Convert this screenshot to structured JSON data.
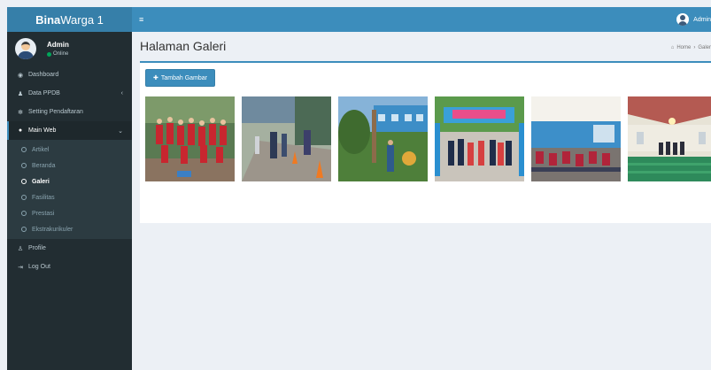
{
  "app": {
    "brand_bold": "Bina",
    "brand_rest": "Warga 1"
  },
  "user": {
    "name": "Admin",
    "status": "Online"
  },
  "topbar": {
    "menu_icon": "hamburger-icon",
    "user_label": "Admin"
  },
  "sidebar": {
    "items": [
      {
        "label": "Dashboard",
        "icon": "dashboard-icon"
      },
      {
        "label": "Data PPDB",
        "icon": "users-icon",
        "caret": "‹"
      },
      {
        "label": "Setting Pendaftaran",
        "icon": "gear-icon"
      },
      {
        "label": "Main Web",
        "icon": "globe-icon",
        "caret": "⌄"
      }
    ],
    "sub_items": [
      {
        "label": "Artikel"
      },
      {
        "label": "Beranda"
      },
      {
        "label": "Galeri"
      },
      {
        "label": "Fasilitas"
      },
      {
        "label": "Prestasi"
      },
      {
        "label": "Ekstrakurikuler"
      }
    ],
    "bottom_items": [
      {
        "label": "Profile",
        "icon": "user-icon"
      },
      {
        "label": "Log Out",
        "icon": "logout-icon"
      }
    ]
  },
  "page": {
    "title": "Halaman Galeri",
    "breadcrumb": [
      "Home",
      "›",
      "Galer"
    ]
  },
  "actions": {
    "add_image_label": "Tambah Gambar"
  },
  "colors": {
    "primary": "#3c8dbc",
    "sidebar": "#222d32",
    "online": "#00a65a"
  }
}
